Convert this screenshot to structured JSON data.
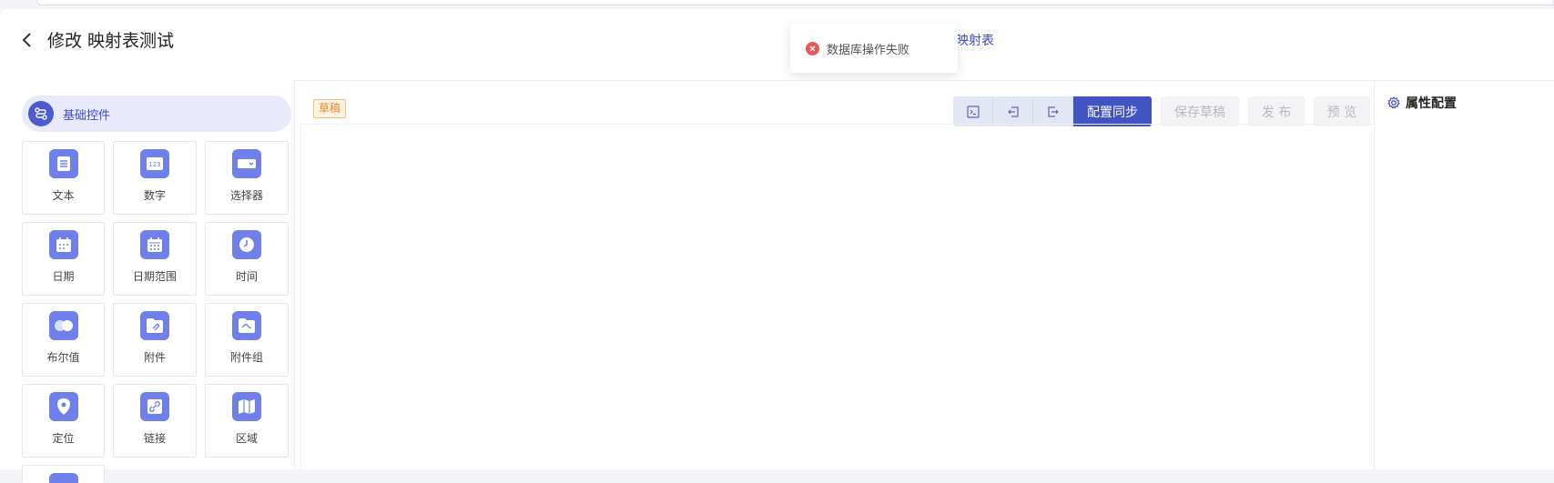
{
  "header": {
    "back_icon": "chevron-left-icon",
    "title": "修改 映射表测试",
    "link_text": "映射表"
  },
  "toast": {
    "icon": "error-circle-icon",
    "message": "数据库操作失败",
    "color": "#f05454"
  },
  "left_panel": {
    "group_label": "基础控件",
    "group_icon": "flow-icon",
    "widgets": [
      {
        "label": "文本",
        "icon": "text-icon"
      },
      {
        "label": "数字",
        "icon": "number-icon"
      },
      {
        "label": "选择器",
        "icon": "selector-icon"
      },
      {
        "label": "日期",
        "icon": "date-icon"
      },
      {
        "label": "日期范围",
        "icon": "date-range-icon"
      },
      {
        "label": "时间",
        "icon": "clock-icon"
      },
      {
        "label": "布尔值",
        "icon": "toggle-icon"
      },
      {
        "label": "附件",
        "icon": "attachment-icon"
      },
      {
        "label": "附件组",
        "icon": "attachment-group-icon"
      },
      {
        "label": "定位",
        "icon": "location-icon"
      },
      {
        "label": "链接",
        "icon": "link-icon"
      },
      {
        "label": "区域",
        "icon": "map-icon"
      }
    ]
  },
  "canvas": {
    "draft_tag": "草稿",
    "toolbar": {
      "icon1": "terminal-icon",
      "icon2": "import-icon",
      "icon3": "export-icon",
      "sync_config": "配置同步",
      "save_draft": "保存草稿",
      "publish": "发 布",
      "preview": "预 览"
    }
  },
  "right_panel": {
    "title": "属性配置",
    "icon": "gear-icon"
  },
  "colors": {
    "accent": "#4253c4",
    "widget_icon_bg": "#6f80ea",
    "group_bg": "#e8eafb",
    "draft": "#e08a2a"
  }
}
